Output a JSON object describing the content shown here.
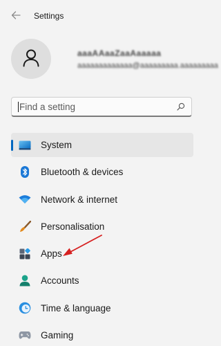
{
  "header": {
    "title": "Settings",
    "back_icon": "back-arrow-icon"
  },
  "account": {
    "avatar_icon": "user-icon",
    "name": "aaaAAaaZaaAaaaaa",
    "email": "aaaaaaaaaaaaa@aaaaaaaaa.aaaaaaaaa"
  },
  "search": {
    "placeholder": "Find a setting",
    "value": "",
    "icon": "search-icon"
  },
  "nav": {
    "items": [
      {
        "label": "System",
        "icon": "system-monitor-icon",
        "selected": true
      },
      {
        "label": "Bluetooth & devices",
        "icon": "bluetooth-icon",
        "selected": false
      },
      {
        "label": "Network & internet",
        "icon": "wifi-icon",
        "selected": false
      },
      {
        "label": "Personalisation",
        "icon": "brush-icon",
        "selected": false
      },
      {
        "label": "Apps",
        "icon": "apps-icon",
        "selected": false
      },
      {
        "label": "Accounts",
        "icon": "accounts-icon",
        "selected": false
      },
      {
        "label": "Time & language",
        "icon": "time-language-icon",
        "selected": false
      },
      {
        "label": "Gaming",
        "icon": "gamepad-icon",
        "selected": false
      }
    ]
  },
  "colors": {
    "background": "#f3f3f3",
    "accent": "#0067c0",
    "selected_item": "#e6e6e6",
    "annotation_arrow": "#d62020"
  }
}
